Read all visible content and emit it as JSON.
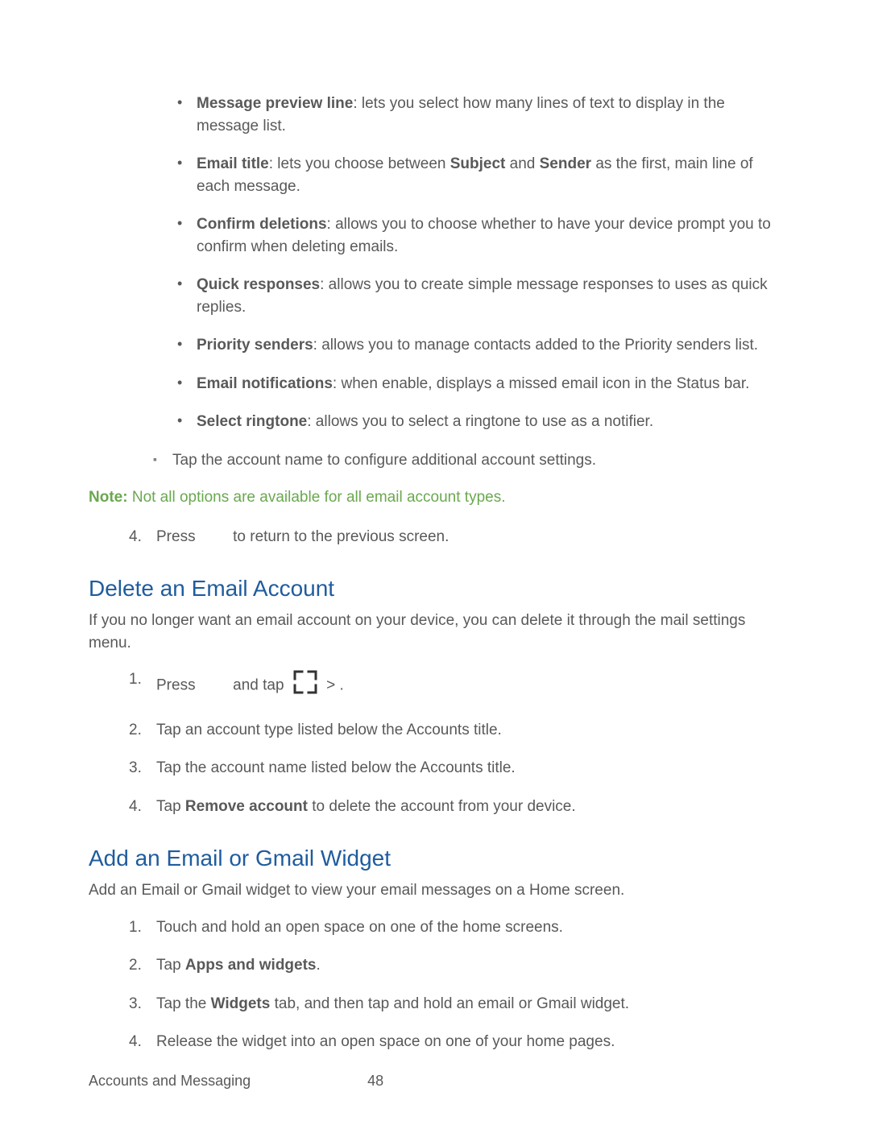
{
  "bullets": [
    {
      "term": "Message preview line",
      "desc": ": lets you select how many lines of text to display in the message list."
    },
    {
      "term": "Email title",
      "desc_pre": ": lets you choose between ",
      "bold1": "Subject",
      "mid": " and ",
      "bold2": "Sender",
      "desc_post": " as the first, main line of each message."
    },
    {
      "term": "Confirm deletions",
      "desc": ": allows you to choose whether to have your device prompt you to confirm when deleting emails."
    },
    {
      "term": "Quick responses",
      "desc": ": allows you to create simple message responses to uses as quick replies."
    },
    {
      "term": "Priority senders",
      "desc": ": allows you to manage contacts added to the Priority senders list."
    },
    {
      "term": "Email notifications",
      "desc": ":  when enable, displays a missed email icon in the Status bar."
    },
    {
      "term": "Select ringtone",
      "desc": ": allows you to select a ringtone to use as a notifier."
    }
  ],
  "sub_bullet": "Tap the account name to configure additional account settings.",
  "note": {
    "label": "Note:",
    "text": "  Not all options are available for all email account types."
  },
  "step4": {
    "pre": "Press ",
    "post": " to return to the previous screen."
  },
  "section_delete": {
    "title": "Delete an Email Account",
    "intro": "If you no longer want an email account on your device, you can delete it through the mail settings menu.",
    "steps": {
      "s1_pre": "Press ",
      "s1_mid": " and tap ",
      "s1_gt": ">",
      "s1_post": "       .",
      "s2": "Tap an account type listed below the Accounts title.",
      "s3": "Tap the account name listed below the Accounts title.",
      "s4_pre": "Tap ",
      "s4_bold": "Remove account",
      "s4_post": " to delete the account from your device."
    }
  },
  "section_widget": {
    "title": "Add an Email or Gmail Widget",
    "intro": "Add an Email or Gmail widget to view your email messages on a Home screen.",
    "steps": {
      "s1": "Touch and hold an open space on one of the home screens.",
      "s2_pre": "Tap ",
      "s2_bold": "Apps and widgets",
      "s2_post": ".",
      "s3_pre": "Tap the ",
      "s3_bold": "Widgets",
      "s3_post": " tab, and then tap and hold an email or Gmail widget.",
      "s4": "Release the widget into an open space on one of your home pages."
    }
  },
  "footer": {
    "section": "Accounts and Messaging",
    "page": "48"
  }
}
